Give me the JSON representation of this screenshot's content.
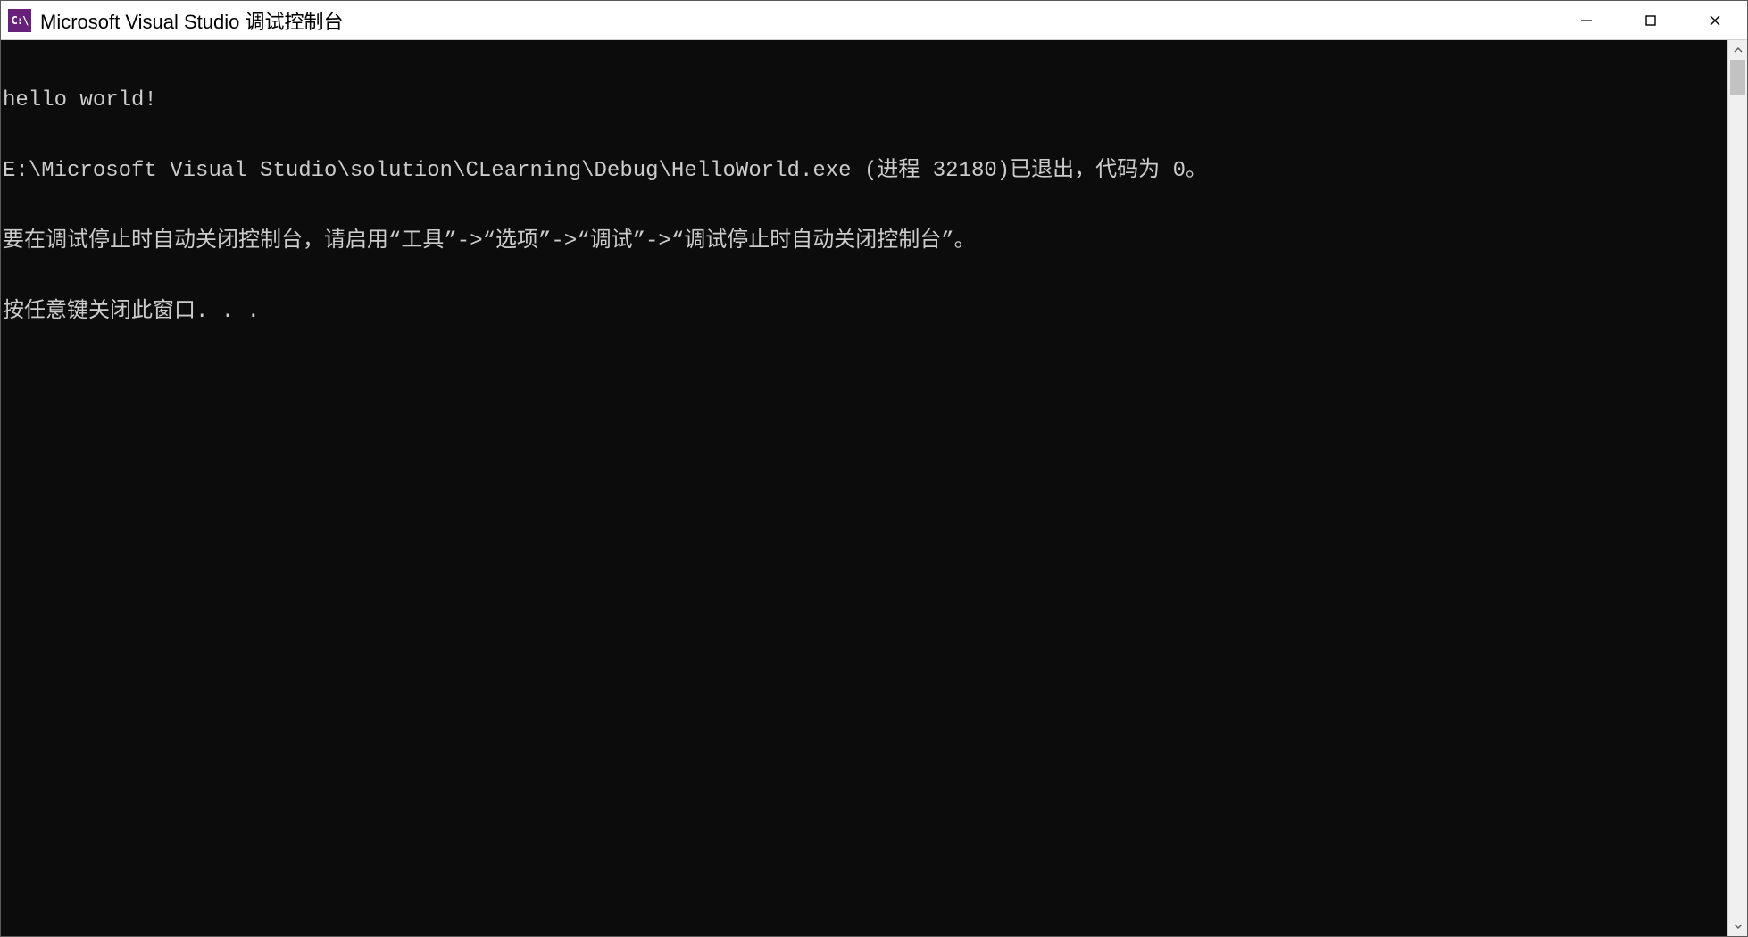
{
  "window": {
    "title": "Microsoft Visual Studio 调试控制台",
    "app_icon_text": "C:\\"
  },
  "console": {
    "lines": [
      "hello world!",
      "E:\\Microsoft Visual Studio\\solution\\CLearning\\Debug\\HelloWorld.exe (进程 32180)已退出，代码为 0。",
      "要在调试停止时自动关闭控制台，请启用“工具”->“选项”->“调试”->“调试停止时自动关闭控制台”。",
      "按任意键关闭此窗口. . ."
    ]
  }
}
